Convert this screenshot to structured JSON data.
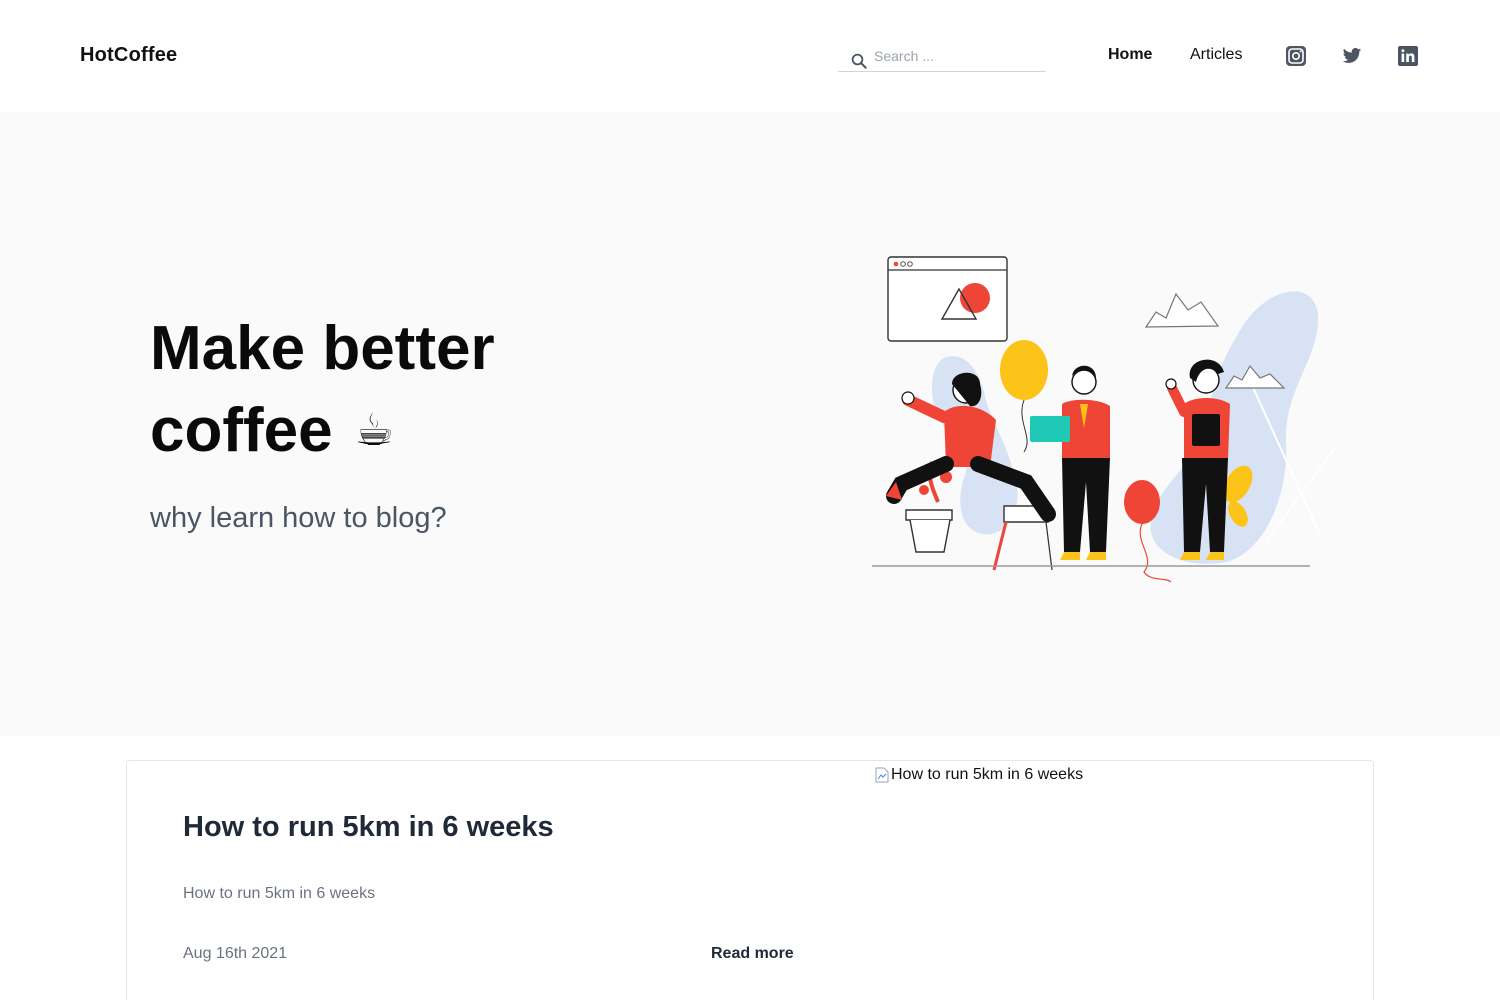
{
  "header": {
    "brand": "HotCoffee",
    "search": {
      "placeholder": "Search ...",
      "value": "",
      "icon": "search-icon"
    },
    "nav": [
      {
        "label": "Home",
        "active": true
      },
      {
        "label": "Articles",
        "active": false
      }
    ],
    "social": [
      {
        "icon": "instagram-icon"
      },
      {
        "icon": "twitter-icon"
      },
      {
        "icon": "linkedin-icon"
      }
    ]
  },
  "hero": {
    "title_line1": "Make better",
    "title_line2": "coffee",
    "title_emoji": "☕",
    "subtitle": "why learn how to blog?",
    "illustration": "people-celebrating-illustration"
  },
  "articles": [
    {
      "title": "How to run 5km in 6 weeks",
      "excerpt": "How to run 5km in 6 weeks",
      "date": "Aug 16th 2021",
      "read_more": "Read more",
      "image_alt": "How to run 5km in 6 weeks"
    }
  ],
  "colors": {
    "hero_bg": "#fafafa",
    "accent_red": "#ef4536",
    "accent_yellow": "#fcc419",
    "accent_teal": "#20c9b5",
    "blob_blue": "#d7e3f4",
    "text_dark": "#1f2937",
    "text_muted": "#6b7280",
    "icon_gray": "#4b5563"
  }
}
